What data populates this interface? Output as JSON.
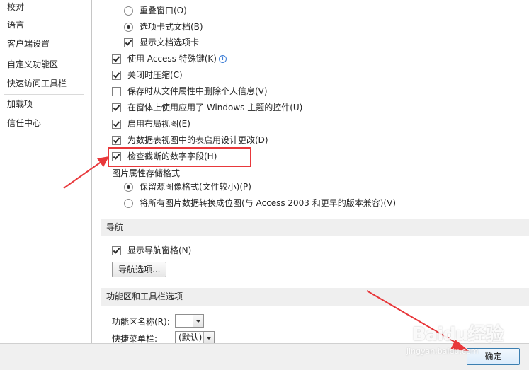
{
  "sidebar": {
    "items": [
      {
        "label": "校对"
      },
      {
        "label": "语言"
      },
      {
        "label": "客户端设置"
      },
      {
        "label": "自定义功能区"
      },
      {
        "label": "快速访问工具栏"
      },
      {
        "label": "加载项"
      },
      {
        "label": "信任中心"
      }
    ]
  },
  "options": {
    "overlap_windows": {
      "label": "重叠窗口(O)",
      "checked": false
    },
    "tabbed_documents": {
      "label": "选项卡式文档(B)",
      "checked": true
    },
    "show_document_tabs": {
      "label": "显示文档选项卡",
      "checked": true
    },
    "access_special_keys": {
      "label": "使用 Access 特殊键(K)",
      "checked": true
    },
    "compact_on_close": {
      "label": "关闭时压缩(C)",
      "checked": true
    },
    "remove_personal_info": {
      "label": "保存时从文件属性中删除个人信息(V)",
      "checked": false
    },
    "windows_themed_controls": {
      "label": "在窗体上使用应用了 Windows 主题的控件(U)",
      "checked": true
    },
    "enable_layout_view": {
      "label": "启用布局视图(E)",
      "checked": true
    },
    "enable_design_changes": {
      "label": "为数据表视图中的表启用设计更改(D)",
      "checked": true
    },
    "check_truncated_fields": {
      "label": "检查截断的数字字段(H)",
      "checked": true
    },
    "picture_format_label": "图片属性存储格式",
    "preserve_source_format": {
      "label": "保留源图像格式(文件较小)(P)",
      "checked": true
    },
    "convert_all_pictures": {
      "label": "将所有图片数据转换成位图(与 Access 2003 和更早的版本兼容)(V)",
      "checked": false
    }
  },
  "navigation": {
    "header": "导航",
    "show_nav_pane": {
      "label": "显示导航窗格(N)",
      "checked": true
    },
    "nav_options_button": "导航选项..."
  },
  "ribbon": {
    "header": "功能区和工具栏选项",
    "ribbon_name_label": "功能区名称(R):",
    "ribbon_name_value": "",
    "shortcut_menu_label": "快捷菜单栏:",
    "shortcut_menu_value": "(默认)"
  },
  "footer": {
    "ok_button": "确定"
  },
  "watermark": {
    "main": "Baidu经验",
    "sub": "jingyan.baidu.com"
  },
  "colors": {
    "annotation_red": "#e8383b",
    "section_bg": "#efefef",
    "ok_border": "#3c7fb1"
  }
}
